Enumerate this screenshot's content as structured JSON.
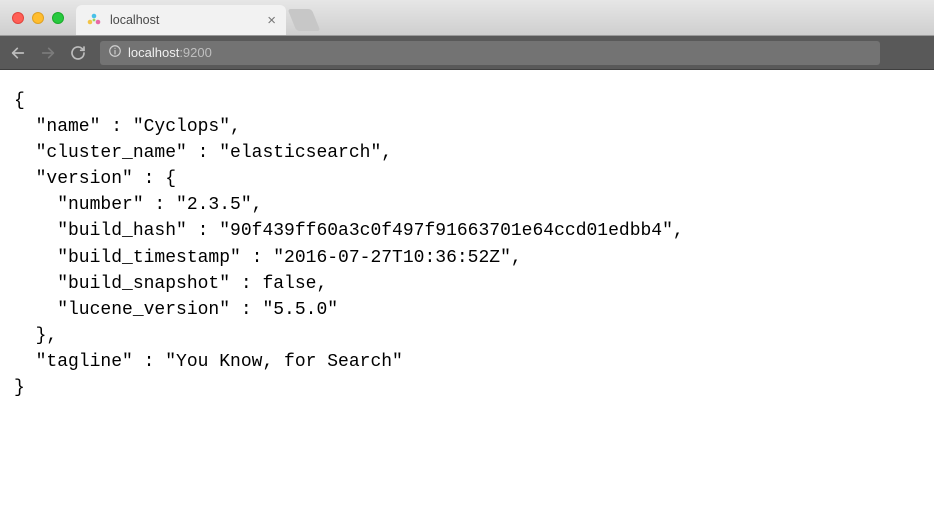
{
  "tab": {
    "title": "localhost"
  },
  "url": {
    "host": "localhost",
    "port": ":9200"
  },
  "json": {
    "line1": "{",
    "line2": "  \"name\" : \"Cyclops\",",
    "line3": "  \"cluster_name\" : \"elasticsearch\",",
    "line4": "  \"version\" : {",
    "line5": "    \"number\" : \"2.3.5\",",
    "line6": "    \"build_hash\" : \"90f439ff60a3c0f497f91663701e64ccd01edbb4\",",
    "line7": "    \"build_timestamp\" : \"2016-07-27T10:36:52Z\",",
    "line8": "    \"build_snapshot\" : false,",
    "line9": "    \"lucene_version\" : \"5.5.0\"",
    "line10": "  },",
    "line11": "  \"tagline\" : \"You Know, for Search\"",
    "line12": "}"
  }
}
